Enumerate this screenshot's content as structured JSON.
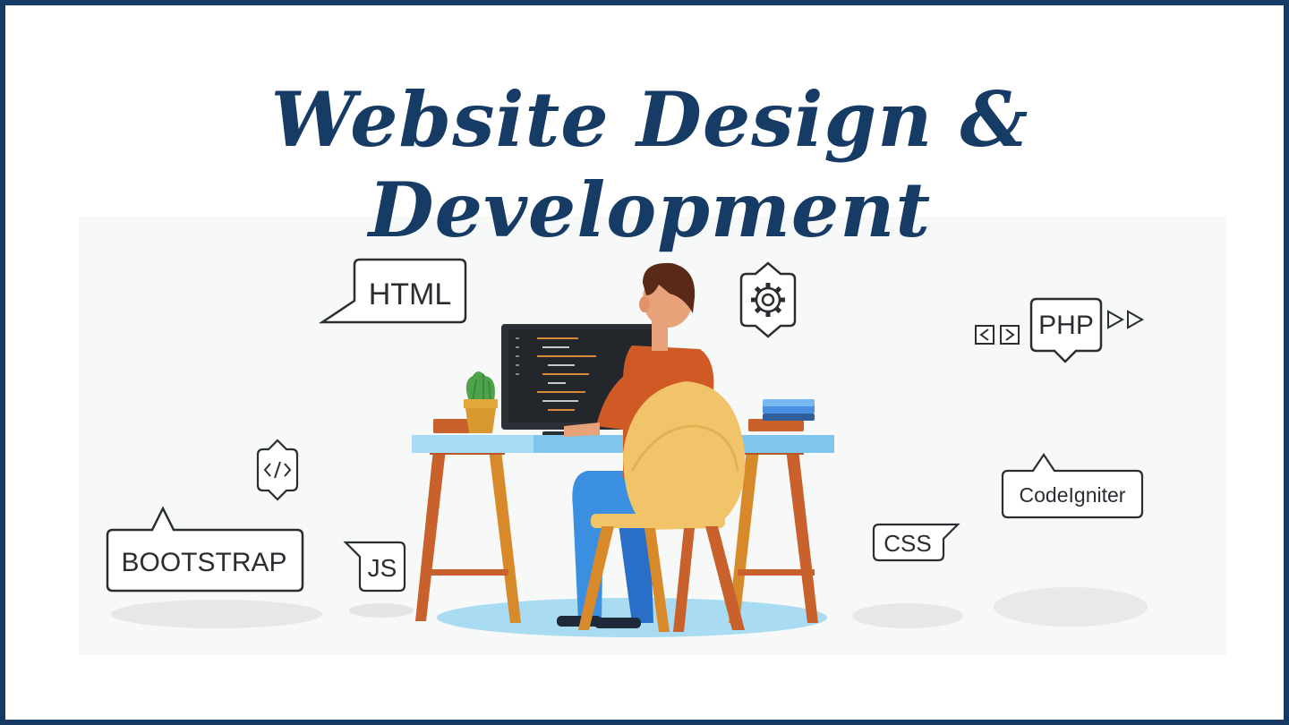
{
  "title": "Website Design & Development",
  "colors": {
    "frame": "#153a63",
    "title": "#163c66",
    "desk_top": "#7ec6ec",
    "desk_legs": "#c8612c",
    "chair": "#f1c46a",
    "shirt": "#cf5a25",
    "pants": "#3b8fe0",
    "monitor": "#2c2f35",
    "floor_shadow": "#a9dcf3"
  },
  "tags": {
    "html": "HTML",
    "php": "PHP",
    "bootstrap": "BOOTSTRAP",
    "js": "JS",
    "css": "CSS",
    "codeigniter": "CodeIgniter"
  },
  "icons": {
    "gear": "gear-icon",
    "code": "code-brackets-icon",
    "nav": "nav-arrows-icon",
    "play": "play-arrows-icon"
  }
}
